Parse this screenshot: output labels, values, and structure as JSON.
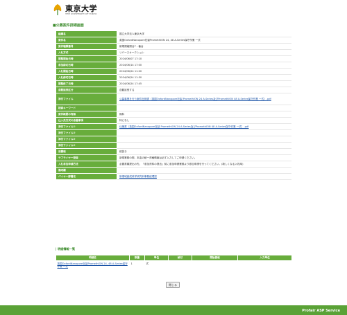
{
  "header": {
    "logo_jp": "東京大学",
    "logo_en": "THE UNIVERSITY OF TOKYO"
  },
  "section_title": "■公募案件詳細画面",
  "details": [
    {
      "label": "組織名",
      "value": "国立大学法人東京大学"
    },
    {
      "label": "案件名",
      "value": "英国OxfordNanopore社製PromethION 24, 48 A-Series保守作業 一式"
    },
    {
      "label": "案件種類番号",
      "value": "新規規格照合7 - 番台"
    },
    {
      "label": "入札方式",
      "value": "リバースオークション"
    },
    {
      "label": "閲覧開始日時",
      "value": "2024/06/07 17:10"
    },
    {
      "label": "参加締切日時",
      "value": "2024/06/14 17:00"
    },
    {
      "label": "入札開始日時",
      "value": "2024/06/24 11:00"
    },
    {
      "label": "入札締切日時",
      "value": "2024/06/24 11:30"
    },
    {
      "label": "閲覧終了日時",
      "value": "2024/06/24 17:45"
    },
    {
      "label": "自動延長区分",
      "value": "自動延長する"
    },
    {
      "label": "添付ファイル",
      "value": "公募事業を行う案件仕様書（英国OxfordNanopore社製 PromethION 24 A-Series及びPromethION 48 A-Series保守作業 一式）.pdf",
      "link": true
    },
    {
      "label": "検索キーワード",
      "value": ""
    },
    {
      "label": "案件概要の有無",
      "value": "無料"
    },
    {
      "label": "仕入先方式の自着事項",
      "value": "特になし"
    },
    {
      "label": "添付ファイル①",
      "value": "仕様書（英国OxfordNanopore社製 PromethION 24 A-Series及びPromethION 48 A-Series保守作業 一式）.pdf",
      "link": true
    },
    {
      "label": "添付ファイル②",
      "value": ""
    },
    {
      "label": "添付ファイル③",
      "value": ""
    },
    {
      "label": "添付ファイル④",
      "value": ""
    },
    {
      "label": "消費税",
      "value": "税抜き"
    },
    {
      "label": "サプライヤー登録",
      "value": "新規業務の際、本金の統一資格情報は必ず入力してご申請ください。"
    },
    {
      "label": "入札参加申請方法",
      "value": "必要書類提出の先、「参加資料の提出」前に参加申請業務より参加申請を行ってください。(新しくなる入札時)"
    },
    {
      "label": "備考欄",
      "value": ""
    },
    {
      "label": "バイヤー部署名",
      "value": "新領域創成科学研究科事務経理担",
      "link": true
    }
  ],
  "items_section": {
    "title": "| 明細情報一覧",
    "columns": [
      "明細名",
      "数量",
      "単位",
      "納付",
      "開始価格",
      "入力単位"
    ],
    "rows": [
      {
        "name": "英国OxfordNanopore社製PromethION 24, 48 A-Series保守作業 一式",
        "qty": "1",
        "unit": "式",
        "delivery": "",
        "start_price": "",
        "input_unit": ""
      }
    ]
  },
  "close_label": "閉じる",
  "footer_text": "Profair ASP Service",
  "colors": {
    "accent": "#68ad3c",
    "footer": "#5aa236",
    "link": "#1d55a8",
    "title": "#3a8a2a"
  },
  "icons": {
    "logo": "university-ginkgo-logo-icon"
  }
}
